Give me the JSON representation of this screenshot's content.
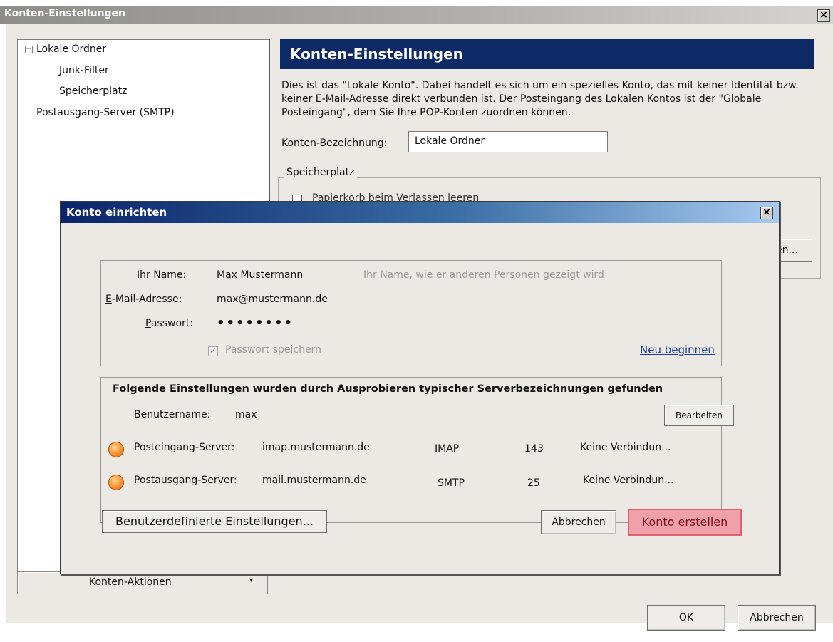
{
  "main_window": {
    "title": "Konten-Einstellungen",
    "close_glyph": "×",
    "tree": {
      "expand_glyph": "−",
      "items": [
        "Lokale Ordner",
        "Junk-Filter",
        "Speicherplatz",
        "Postausgang-Server (SMTP)"
      ]
    },
    "account_actions": {
      "label": "Konten-Aktionen",
      "arrow": "▾"
    },
    "header_title": "Konten-Einstellungen",
    "description": "Dies ist das \"Lokale Konto\". Dabei handelt es sich um ein spezielles Konto, das mit keiner Identität bzw. keiner E-Mail-Adresse direkt verbunden ist. Der Posteingang des Lokalen Kontos ist der \"Globale Posteingang\", dem Sie Ihre POP-Konten zuordnen können.",
    "account_name_label": "Konten-Bezeichnung:",
    "account_name_value": "Lokale Ordner",
    "storage_group_label": "Speicherplatz",
    "storage_checkbox_label": "Papierkorb beim Verlassen leeren",
    "partial_button_label": "en...",
    "ok_label": "OK",
    "cancel_label": "Abbrechen"
  },
  "dialog": {
    "title": "Konto einrichten",
    "close_glyph": "×",
    "name_label": "Ihr Name:",
    "name_value": "Max Mustermann",
    "name_hint": "Ihr Name, wie er anderen Personen gezeigt wird",
    "email_label": "E-Mail-Adresse:",
    "email_value": "max@mustermann.de",
    "password_label": "Passwort:",
    "password_value": "••••••••",
    "remember_label": "Passwort speichern",
    "remember_checked": true,
    "restart_link": "Neu beginnen",
    "found_heading": "Folgende Einstellungen wurden durch Ausprobieren typischer Serverbezeichnungen gefunden",
    "username_label": "Benutzername:",
    "username_value": "max",
    "edit_label": "Bearbeiten",
    "servers": [
      {
        "label": "Posteingang-Server:",
        "host": "imap.mustermann.de",
        "protocol": "IMAP",
        "port": "143",
        "status": "Keine Verbindun..."
      },
      {
        "label": "Postausgang-Server:",
        "host": "mail.mustermann.de",
        "protocol": "SMTP",
        "port": "25",
        "status": "Keine Verbindun..."
      }
    ],
    "custom_settings_label": "Benutzerdefinierte Einstellungen...",
    "cancel_label": "Abbrechen",
    "create_label": "Konto erstellen"
  },
  "colors": {
    "header_bar": "#0e2a66",
    "dialog_titlebar": "#0a246a",
    "create_button": "#f0a0a8",
    "status_dot": "#ff9a3c"
  }
}
